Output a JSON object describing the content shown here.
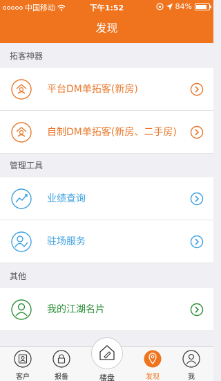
{
  "status_bar": {
    "carrier": "中国移动",
    "time": "下午1:52",
    "battery": "84%",
    "battery_level": 0.84
  },
  "header": {
    "title": "发现"
  },
  "sections": [
    {
      "title": "拓客神器"
    },
    {
      "title": "管理工具"
    },
    {
      "title": "其他"
    }
  ],
  "items": [
    {
      "label": "平台DM单拓客(新房)"
    },
    {
      "label": "自制DM单拓客(新房、二手房)"
    },
    {
      "label": "业绩查询"
    },
    {
      "label": "驻场服务"
    },
    {
      "label": "我的江湖名片"
    }
  ],
  "tabs": [
    {
      "label": "客户"
    },
    {
      "label": "报备"
    },
    {
      "label": "楼盘"
    },
    {
      "label": "发现"
    },
    {
      "label": "我"
    }
  ],
  "colors": {
    "accent": "#f0731d",
    "orange_text": "#e9782c",
    "blue_text": "#3ea1e0",
    "green_text": "#2e8f3a"
  }
}
